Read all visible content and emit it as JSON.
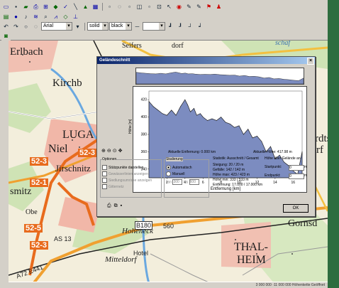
{
  "toolbar": {
    "font_name": "Arial",
    "fill_style": "solid",
    "line_color": "black"
  },
  "map": {
    "places": [
      "Erlbach",
      "Kirchb",
      "LUGA",
      "Niel",
      "Jirschnitz",
      "smitz",
      "rdts",
      "rf",
      "Gornsd",
      "THAL-",
      "HEIM",
      "Hoheneck",
      "Mitteldorf",
      "Seifers",
      "dorf",
      "schaf",
      "Obe"
    ],
    "road_labels": [
      "B180",
      "560",
      "AS 13",
      "A72 E441",
      "Hotel"
    ],
    "route_labels": [
      "52-3",
      "52-3",
      "52-1",
      "52-5",
      "52-3"
    ]
  },
  "status_bar": {
    "text": "3 000 000 ·11 000 000   Höhenkette   Geöffnet"
  },
  "dialog": {
    "title": "Geländeschnitt",
    "close": "×",
    "y_axis_label": "Höhe [m]",
    "x_axis_label": "Entfernung [km]",
    "current_distance": "Aktuelle Entfernung: 0.000 km",
    "current_height": "Aktuelle Höhe: 417.98 m",
    "options": {
      "title": "Optionen",
      "items": [
        "Stützpunkte darstellen",
        "Gewässerlinien anzeigen",
        "Siedlungsumrisse anzeigen",
        "Gitternetz"
      ]
    },
    "scaling": {
      "title": "Skalierung",
      "auto": "Automatisch",
      "manual": "Manuell",
      "from": "von",
      "from_value": "300",
      "to": "bis",
      "to_value": "600"
    },
    "stats": {
      "title": "Statistik:",
      "mode": "Ausschnitt / Gesamt",
      "lines": [
        "Steigung: 20 / 20 m",
        "Gefälle: 142 / 142 m",
        "Höhe max: 423 / 423 m",
        "Höhe min: 333 / 333 m",
        "Entfernung: 17.000 / 17.000 km"
      ]
    },
    "terrain": {
      "title": "Höhe über Gelände an",
      "start": "Startpunkt:",
      "end": "Endpunkt:",
      "start_value": "0",
      "end_value": "0",
      "unit": "m"
    },
    "ok_label": "OK"
  },
  "chart_data": {
    "type": "area",
    "title": "",
    "xlabel": "Entfernung [km]",
    "ylabel": "Höhe [m]",
    "xlim": [
      0,
      17
    ],
    "ylim": [
      330,
      430
    ],
    "x_ticks": [
      2,
      4,
      6,
      8,
      10,
      12,
      14,
      16
    ],
    "y_ticks": [
      340,
      360,
      380,
      400,
      420
    ],
    "fill_color": "#7c8cc0",
    "x": [
      0,
      0.5,
      1,
      1.5,
      2,
      2.5,
      3,
      3.5,
      4,
      4.3,
      4.6,
      5,
      5.3,
      5.7,
      6,
      6.5,
      7,
      7.5,
      8,
      8.5,
      9,
      9.5,
      10,
      10.5,
      11,
      11.5,
      12,
      12.5,
      13,
      13.5,
      14,
      14.5,
      15,
      15.5,
      16,
      16.5,
      17
    ],
    "y": [
      418,
      412,
      408,
      404,
      402,
      408,
      402,
      412,
      420,
      414,
      406,
      410,
      402,
      404,
      400,
      396,
      398,
      396,
      400,
      394,
      392,
      388,
      390,
      380,
      386,
      376,
      378,
      372,
      360,
      366,
      352,
      356,
      348,
      344,
      338,
      334,
      360
    ]
  }
}
